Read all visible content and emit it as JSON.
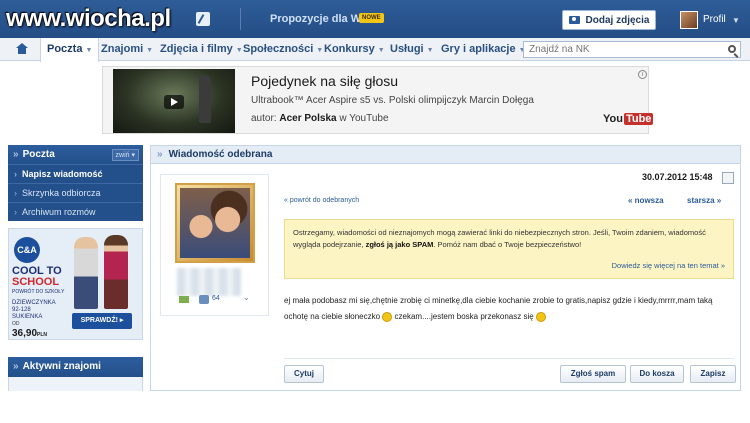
{
  "watermark": "www.wiocha.pl",
  "topbar": {
    "proposals_label": "Propozycje dla Was",
    "new_badge": "NOWE",
    "add_photo_label": "Dodaj zdjęcia",
    "profile_label": "Profil"
  },
  "nav": {
    "items": [
      {
        "label": "Poczta",
        "active": true
      },
      {
        "label": "Znajomi"
      },
      {
        "label": "Zdjęcia i filmy"
      },
      {
        "label": "Społeczności"
      },
      {
        "label": "Konkursy"
      },
      {
        "label": "Usługi"
      },
      {
        "label": "Gry i aplikacje"
      }
    ],
    "search_placeholder": "Znajdź na NK"
  },
  "video_ad": {
    "title": "Pojedynek na siłę głosu",
    "subtitle": "Ultrabook™ Acer Aspire s5 vs. Polski olimpijczyk Marcin Dołęga",
    "author_prefix": "autor:",
    "author": "Acer Polska",
    "author_suffix": "w YouTube",
    "yt_you": "You",
    "yt_tube": "Tube",
    "info_icon": "i"
  },
  "sidebar": {
    "mail_header": "Poczta",
    "collapse_label": "zwiń ▾",
    "links": [
      "Napisz wiadomość",
      "Skrzynka odbiorcza",
      "Archiwum rozmów"
    ],
    "friends_header": "Aktywni znajomi"
  },
  "ca_ad": {
    "logo": "C&A",
    "title_line1": "COOL TO",
    "title_line2": "SCHOOL",
    "small": "POWRÓT DO SZKOŁY",
    "desc_line1": "DZIEWCZYNKA",
    "desc_line2": "92-128",
    "desc_line3": "SUKIENKA",
    "from": "OD",
    "price": "36,90",
    "currency": "PLN",
    "button": "SPRAWDŹ! ▸"
  },
  "message": {
    "header": "Wiadomość odebrana",
    "date": "30.07.2012 15:48",
    "back_link": "« powrót do odebranych",
    "newer": "« nowsza",
    "older": "starsza »",
    "sender_count": "64",
    "warning_part1": "Ostrzegamy, wiadomości od nieznajomych mogą zawierać linki do niebezpiecznych stron. Jeśli, Twoim zdaniem, wiadomość wygląda podejrzanie,",
    "warning_bold": "zgłoś ją jako SPAM",
    "warning_part2": ". Pomóż nam dbać o Twoje bezpieczeństwo!",
    "warning_more": "Dowiedz się więcej na ten temat »",
    "body_part1": "ej mała podobasz mi się,chętnie zrobię ci minetkę,dla ciebie kochanie zrobie to gratis,napisz gdzie i kiedy,mrrrr,mam taką ochotę na ciebie słoneczko",
    "body_part2": " czekam....jestem boska przekonasz się",
    "buttons": {
      "quote": "Cytuj",
      "spam": "Zgłoś spam",
      "trash": "Do kosza",
      "save": "Zapisz"
    }
  },
  "colors": {
    "topbar": "#2f5d98",
    "accent": "#2a5b98",
    "warning_bg": "#fdf4c4"
  }
}
